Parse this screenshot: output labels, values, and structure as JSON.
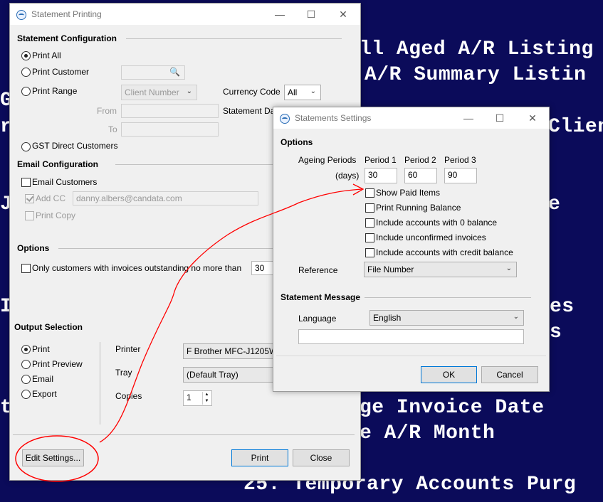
{
  "background": {
    "lines": [
      "ll Aged A/R Listing",
      "A/R Summary Listin",
      "Clien",
      "G",
      "r",
      "J",
      "e",
      "I",
      "es",
      "s",
      "t",
      "ge Invoice Date",
      "e A/R Month",
      "25. Temporary Accounts Purg"
    ]
  },
  "statement_printing": {
    "title": "Statement Printing",
    "config_header": "Statement Configuration",
    "print_all": "Print All",
    "print_customer": "Print Customer",
    "print_range": "Print Range",
    "range_field": "Client Number",
    "currency_code_label": "Currency Code",
    "currency_value": "All",
    "from_label": "From",
    "to_label": "To",
    "statement_date_label": "Statement Da",
    "gst_direct": "GST Direct Customers",
    "email_header": "Email Configuration",
    "email_customers": "Email Customers",
    "add_cc": "Add CC",
    "cc_value": "danny.albers@candata.com",
    "print_copy": "Print Copy",
    "options_header": "Options",
    "outstanding_label": "Only customers with invoices outstanding no more than",
    "outstanding_value": "30",
    "output_header": "Output Selection",
    "out_print": "Print",
    "out_preview": "Print Preview",
    "out_email": "Email",
    "out_export": "Export",
    "printer_label": "Printer",
    "printer_value": "F Brother MFC-J1205W",
    "tray_label": "Tray",
    "tray_value": "(Default Tray)",
    "copies_label": "Copies",
    "copies_value": "1",
    "edit_settings": "Edit Settings...",
    "print_button": "Print",
    "close_button": "Close"
  },
  "statements_settings": {
    "title": "Statements Settings",
    "options_header": "Options",
    "ageing_label": "Ageing Periods",
    "days_label": "(days)",
    "periods": [
      {
        "label": "Period 1",
        "value": "30"
      },
      {
        "label": "Period 2",
        "value": "60"
      },
      {
        "label": "Period 3",
        "value": "90"
      }
    ],
    "checkboxes": [
      "Show Paid Items",
      "Print Running Balance",
      "Include accounts with 0 balance",
      "Include unconfirmed invoices",
      "Include accounts with credit balance"
    ],
    "reference_label": "Reference",
    "reference_value": "File Number",
    "message_header": "Statement Message",
    "language_label": "Language",
    "language_value": "English",
    "message_value": "",
    "ok_button": "OK",
    "cancel_button": "Cancel"
  },
  "annotation_color": "#ff0000"
}
